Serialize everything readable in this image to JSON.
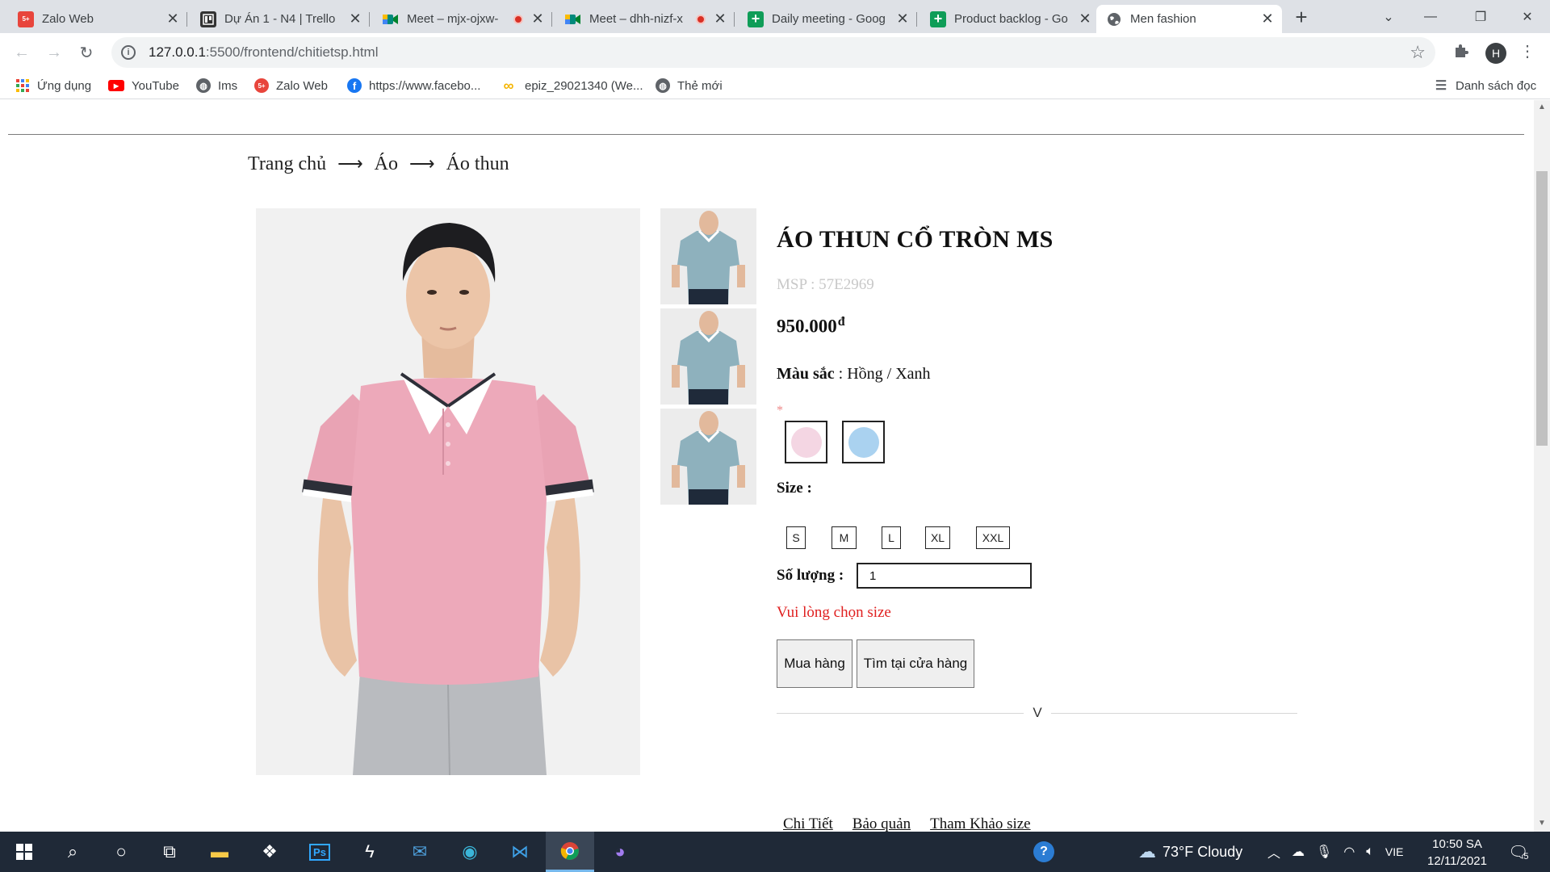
{
  "browser": {
    "tabs": [
      {
        "title": "Zalo Web",
        "favicon_color": "#e8453c",
        "favicon_text": "Zalo",
        "recording": false,
        "active": false
      },
      {
        "title": "Dự Án 1 - N4 | Trello",
        "favicon_color": "#333333",
        "favicon_text": "",
        "recording": false,
        "active": false
      },
      {
        "title": "Meet – mjx-ojxw-",
        "favicon_color": "#00897b",
        "favicon_text": "",
        "recording": true,
        "active": false
      },
      {
        "title": "Meet – dhh-nizf-x",
        "favicon_color": "#00897b",
        "favicon_text": "",
        "recording": true,
        "active": false
      },
      {
        "title": "Daily meeting - Goog",
        "favicon_color": "#0f9d58",
        "favicon_text": "+",
        "recording": false,
        "active": false
      },
      {
        "title": "Product backlog - Go",
        "favicon_color": "#0f9d58",
        "favicon_text": "+",
        "recording": false,
        "active": false
      },
      {
        "title": "Men fashion",
        "favicon_color": "#5f6368",
        "favicon_text": "",
        "recording": false,
        "active": true
      }
    ],
    "address": {
      "host": "127.0.0.1",
      "path": ":5500/frontend/chitietsp.html"
    },
    "profile_initial": "H",
    "bookmarks": [
      {
        "label": "Ứng dụng",
        "icon": "apps-grid-icon"
      },
      {
        "label": "YouTube",
        "icon": "youtube-icon",
        "color": "#ff0000"
      },
      {
        "label": "Ims",
        "icon": "globe-icon",
        "color": "#5f6368"
      },
      {
        "label": "Zalo Web",
        "icon": "zalo-icon",
        "color": "#e8453c"
      },
      {
        "label": "https://www.facebo...",
        "icon": "facebook-icon",
        "color": "#1877f2"
      },
      {
        "label": "epiz_29021340 (We...",
        "icon": "infinity-icon",
        "color": "#f4b400"
      },
      {
        "label": "Thẻ mới",
        "icon": "globe-icon",
        "color": "#5f6368"
      }
    ],
    "reading_list": "Danh sách đọc"
  },
  "breadcrumb": {
    "home": "Trang chủ",
    "category": "Áo",
    "subcategory": "Áo thun",
    "separator": "⟶"
  },
  "product": {
    "title": "ÁO THUN CỔ TRÒN MS",
    "sku": "MSP : 57E2969",
    "price": "950.000",
    "currency": "đ",
    "color_label": "Màu sắc",
    "color_value": ": Hồng / Xanh",
    "required_mark": "*",
    "swatches": [
      {
        "name": "pink",
        "color": "#f4d6e3"
      },
      {
        "name": "blue",
        "color": "#aad2f0"
      }
    ],
    "size_label": "Size :",
    "sizes": [
      "S",
      "M",
      "L",
      "XL",
      "XXL"
    ],
    "qty_label": "Số lượng :",
    "qty_value": "1",
    "warning": "Vui lòng chọn size",
    "buy_button": "Mua hàng",
    "find_store_button": "Tìm tại cửa hàng",
    "expand_label": "V",
    "info_tabs": [
      "Chi Tiết",
      "Bảo quản",
      "Tham Khảo size"
    ]
  },
  "taskbar": {
    "weather": "73°F  Cloudy",
    "language": "VIE",
    "time": "10:50 SA",
    "date": "12/11/2021",
    "notification_count": "5"
  }
}
